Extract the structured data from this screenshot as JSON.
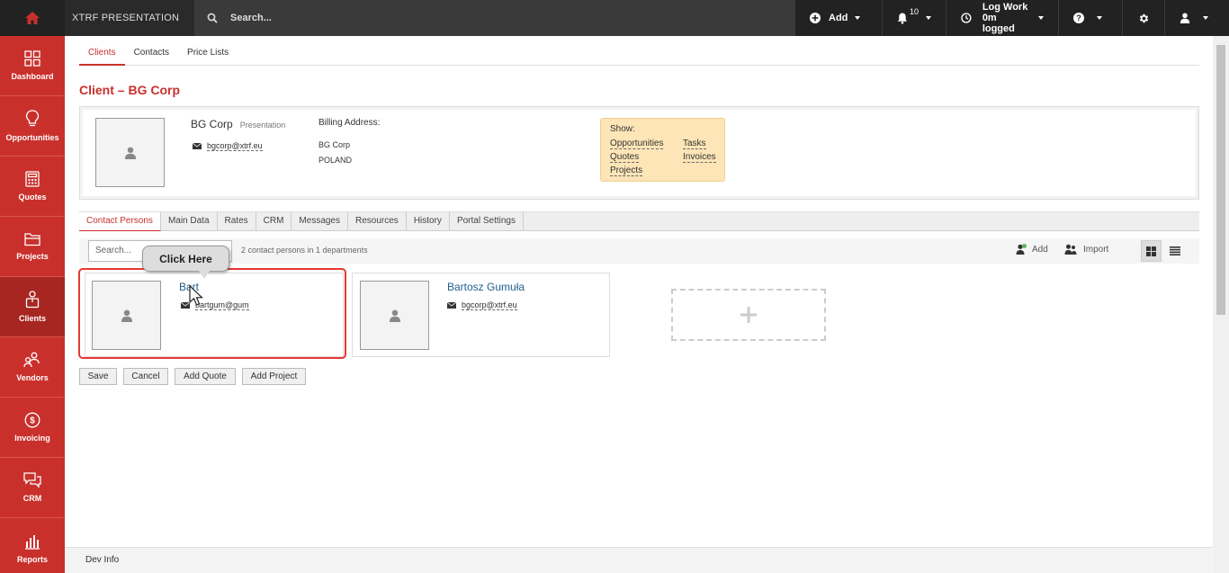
{
  "topbar": {
    "brand": "XTRF PRESENTATION",
    "search_placeholder": "Search...",
    "add_label": "Add",
    "notifications_count": "10",
    "logwork_line1": "Log Work",
    "logwork_line2": "0m logged"
  },
  "sidebar": {
    "items": [
      {
        "label": "Dashboard"
      },
      {
        "label": "Opportunities"
      },
      {
        "label": "Quotes"
      },
      {
        "label": "Projects"
      },
      {
        "label": "Clients"
      },
      {
        "label": "Vendors"
      },
      {
        "label": "Invoicing"
      },
      {
        "label": "CRM"
      },
      {
        "label": "Reports"
      }
    ]
  },
  "top_tabs": [
    "Clients",
    "Contacts",
    "Price Lists"
  ],
  "page_title": "Client – BG Corp",
  "client": {
    "name": "BG Corp",
    "tag": "Presentation",
    "email": "bgcorp@xtrf.eu",
    "billing_label": "Billing Address:",
    "billing_line1": "BG Corp",
    "billing_line2": "POLAND"
  },
  "show_box": {
    "label": "Show:",
    "links": [
      "Opportunities",
      "Tasks",
      "Quotes",
      "Invoices",
      "Projects"
    ]
  },
  "contact_tabs": [
    "Contact Persons",
    "Main Data",
    "Rates",
    "CRM",
    "Messages",
    "Resources",
    "History",
    "Portal Settings"
  ],
  "toolbar": {
    "search_placeholder": "Search...",
    "count_text": "2 contact persons in 1 departments",
    "add_label": "Add",
    "import_label": "Import"
  },
  "contacts": [
    {
      "name": "Bart",
      "email": "bartgum@gum"
    },
    {
      "name": "Bartosz Gumuła",
      "email": "bgcorp@xtrf.eu"
    }
  ],
  "buttons": {
    "save": "Save",
    "cancel": "Cancel",
    "add_quote": "Add Quote",
    "add_project": "Add Project"
  },
  "tooltip": "Click Here",
  "footer": "Dev Info",
  "colors": {
    "brand_red": "#c9302c",
    "topbar_dark": "#222222",
    "show_box_bg": "#fde5b7",
    "highlight": "#e53935",
    "link_blue": "#1f5e8f"
  }
}
